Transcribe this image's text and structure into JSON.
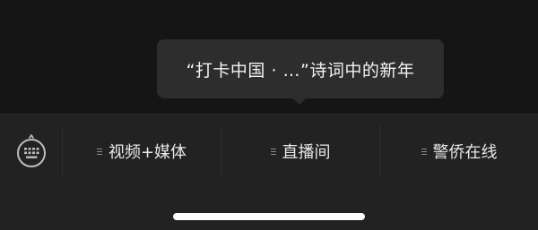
{
  "tooltip": {
    "text": "“打卡中国 · …”诗词中的新年"
  },
  "bottom_menu": {
    "keyboard_icon": "keyboard-icon",
    "menu_icon": "menu-lines-icon",
    "items": [
      {
        "label": "视频+媒体"
      },
      {
        "label": "直播间"
      },
      {
        "label": "警侨在线"
      }
    ]
  },
  "colors": {
    "background": "#151515",
    "bar_background": "#222222",
    "tooltip_background": "#2d2d2d",
    "text": "#e8e8e8",
    "home_indicator": "#ffffff"
  }
}
